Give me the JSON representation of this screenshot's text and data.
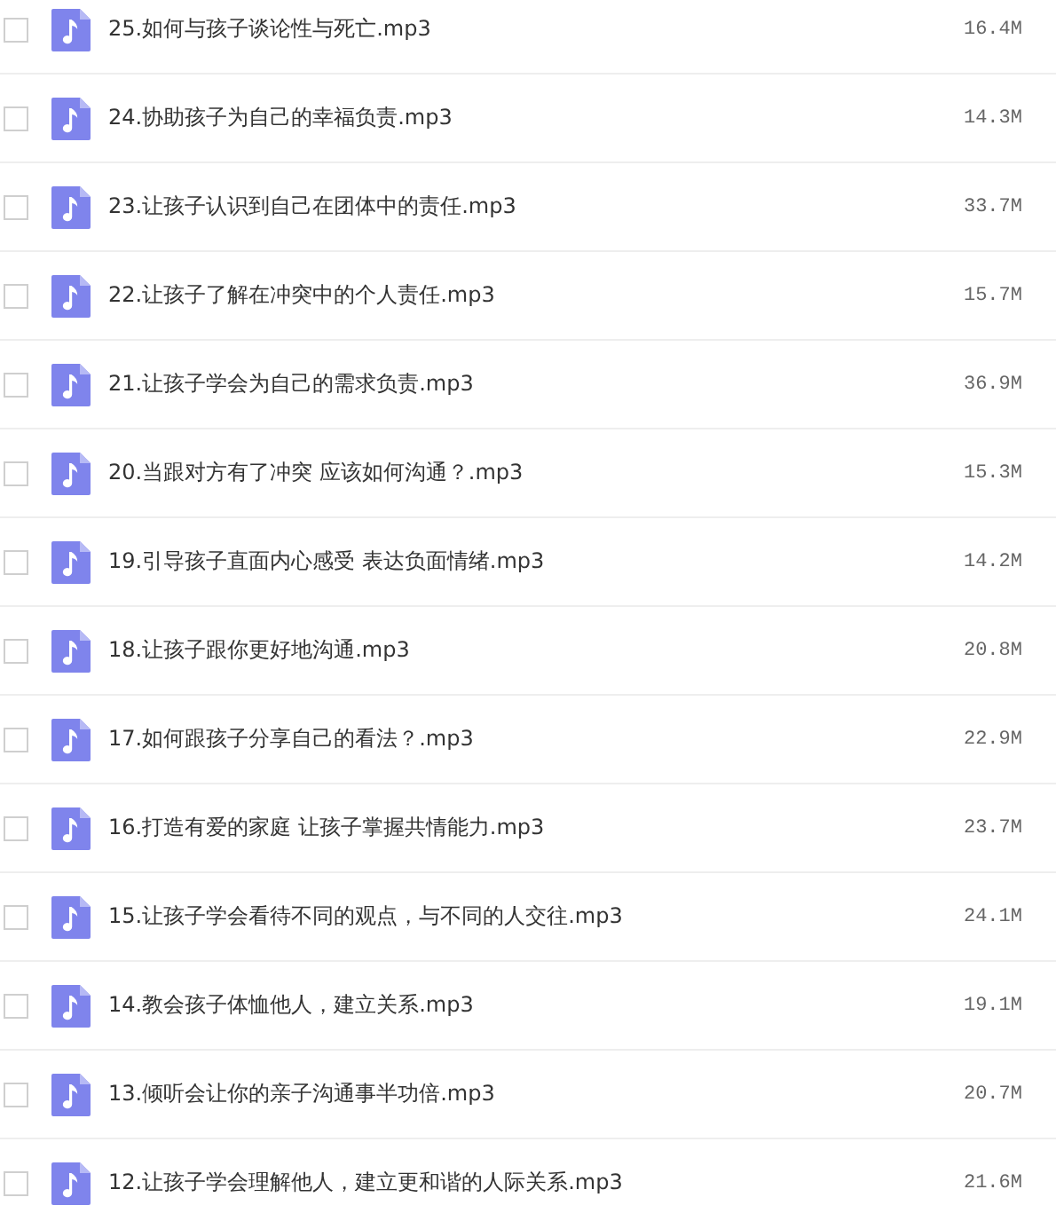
{
  "files": [
    {
      "name": "25.如何与孩子谈论性与死亡.mp3",
      "size": "16.4M",
      "checked": false
    },
    {
      "name": "24.协助孩子为自己的幸福负责.mp3",
      "size": "14.3M",
      "checked": false
    },
    {
      "name": "23.让孩子认识到自己在团体中的责任.mp3",
      "size": "33.7M",
      "checked": false
    },
    {
      "name": "22.让孩子了解在冲突中的个人责任.mp3",
      "size": "15.7M",
      "checked": false
    },
    {
      "name": "21.让孩子学会为自己的需求负责.mp3",
      "size": "36.9M",
      "checked": false
    },
    {
      "name": "20.当跟对方有了冲突 应该如何沟通？.mp3",
      "size": "15.3M",
      "checked": false
    },
    {
      "name": "19.引导孩子直面内心感受 表达负面情绪.mp3",
      "size": "14.2M",
      "checked": false
    },
    {
      "name": "18.让孩子跟你更好地沟通.mp3",
      "size": "20.8M",
      "checked": false
    },
    {
      "name": "17.如何跟孩子分享自己的看法？.mp3",
      "size": "22.9M",
      "checked": false
    },
    {
      "name": "16.打造有爱的家庭 让孩子掌握共情能力.mp3",
      "size": "23.7M",
      "checked": false
    },
    {
      "name": "15.让孩子学会看待不同的观点，与不同的人交往.mp3",
      "size": "24.1M",
      "checked": false
    },
    {
      "name": "14.教会孩子体恤他人，建立关系.mp3",
      "size": "19.1M",
      "checked": false
    },
    {
      "name": "13.倾听会让你的亲子沟通事半功倍.mp3",
      "size": "20.7M",
      "checked": false
    },
    {
      "name": "12.让孩子学会理解他人，建立更和谐的人际关系.mp3",
      "size": "21.6M",
      "checked": false
    }
  ]
}
